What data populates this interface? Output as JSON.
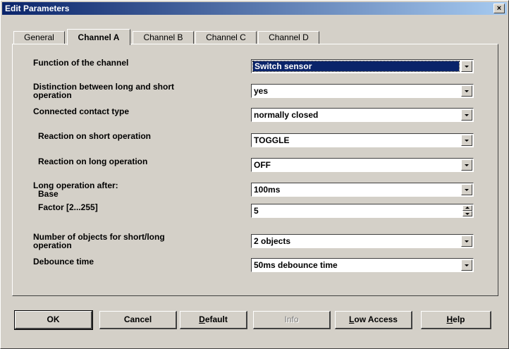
{
  "window": {
    "title": "Edit Parameters",
    "close_glyph": "×"
  },
  "tabs": [
    {
      "label": "General"
    },
    {
      "label": "Channel A"
    },
    {
      "label": "Channel B"
    },
    {
      "label": "Channel C"
    },
    {
      "label": "Channel D"
    }
  ],
  "fields": {
    "function": {
      "label": "Function of the channel",
      "value": "Switch sensor"
    },
    "distinction": {
      "label_line1": "Distinction between long and short",
      "label_line2": "operation",
      "value": "yes"
    },
    "contact": {
      "label": "Connected contact type",
      "value": "normally closed"
    },
    "short_reaction": {
      "label": "Reaction on short operation",
      "value": "TOGGLE"
    },
    "long_reaction": {
      "label": "Reaction on long operation",
      "value": "OFF"
    },
    "long_after": {
      "label_line1": "Long operation after:",
      "label_line2": "Base",
      "value": "100ms"
    },
    "factor": {
      "label": "Factor [2...255]",
      "value": "5"
    },
    "objects": {
      "label_line1": "Number of objects for short/long",
      "label_line2": "operation",
      "value": "2 objects"
    },
    "debounce": {
      "label": "Debounce time",
      "value": "50ms debounce time"
    }
  },
  "buttons": {
    "ok": "OK",
    "cancel": "Cancel",
    "default_first": "D",
    "default_rest": "efault",
    "info": "Info",
    "low_access_first": "L",
    "low_access_rest": "ow Access",
    "help_first": "H",
    "help_rest": "elp"
  }
}
